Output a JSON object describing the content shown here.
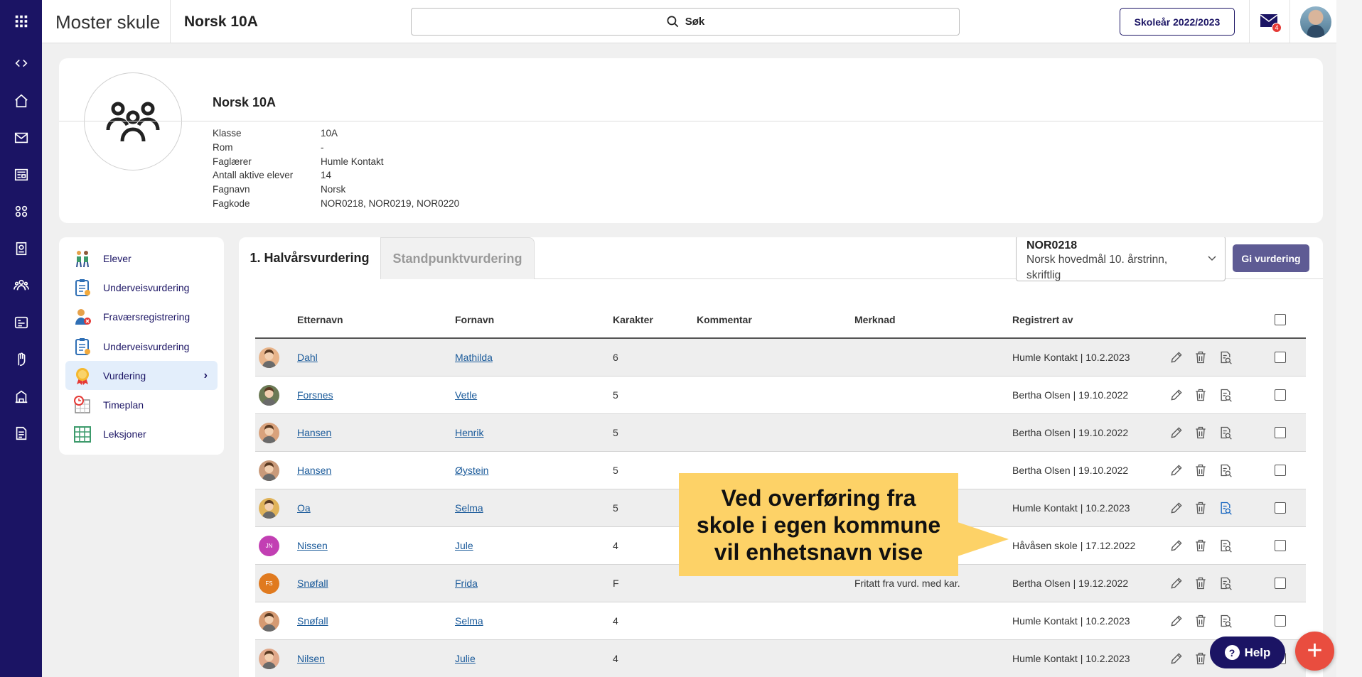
{
  "topbar": {
    "app_title": "Moster skule",
    "context_title": "Norsk 10A",
    "search_label": "Søk",
    "school_year_button": "Skoleår 2022/2023",
    "mail_badge": "4"
  },
  "group": {
    "title": "Norsk 10A",
    "info": [
      {
        "key": "Klasse",
        "value": "10A"
      },
      {
        "key": "Rom",
        "value": "-"
      },
      {
        "key": "Faglærer",
        "value": "Humle Kontakt"
      },
      {
        "key": "Antall aktive elever",
        "value": "14"
      },
      {
        "key": "Fagnavn",
        "value": "Norsk"
      },
      {
        "key": "Fagkode",
        "value": "NOR0218, NOR0219, NOR0220"
      }
    ]
  },
  "side_menu": {
    "items": [
      {
        "label": "Elever",
        "icon": "students-icon"
      },
      {
        "label": "Underveisvurdering",
        "icon": "clipboard-icon"
      },
      {
        "label": "Fraværsregistrering",
        "icon": "absence-icon"
      },
      {
        "label": "Underveisvurdering",
        "icon": "clipboard-icon"
      },
      {
        "label": "Vurdering",
        "icon": "medal-icon",
        "active": true
      },
      {
        "label": "Timeplan",
        "icon": "schedule-icon"
      },
      {
        "label": "Leksjoner",
        "icon": "lessons-icon"
      }
    ]
  },
  "tabs": {
    "tab1": "1. Halvårsvurdering",
    "tab2": "Standpunktvurdering"
  },
  "course_select": {
    "code": "NOR0218",
    "name": "Norsk hovedmål 10. årstrinn, skriftlig"
  },
  "give_button": "Gi vurdering",
  "table": {
    "headers": {
      "etternavn": "Etternavn",
      "fornavn": "Fornavn",
      "karakter": "Karakter",
      "kommentar": "Kommentar",
      "merknad": "Merknad",
      "registrert": "Registrert av"
    },
    "rows": [
      {
        "etternavn": "Dahl",
        "fornavn": "Mathilda",
        "karakter": "6",
        "kommentar": "",
        "merknad": "",
        "registrert": "Humle Kontakt | 10.2.2023",
        "avatar": "photo"
      },
      {
        "etternavn": "Forsnes",
        "fornavn": "Vetle",
        "karakter": "5",
        "kommentar": "",
        "merknad": "",
        "registrert": "Bertha Olsen | 19.10.2022",
        "avatar": "photo"
      },
      {
        "etternavn": "Hansen",
        "fornavn": "Henrik",
        "karakter": "5",
        "kommentar": "",
        "merknad": "",
        "registrert": "Bertha Olsen | 19.10.2022",
        "avatar": "photo"
      },
      {
        "etternavn": "Hansen",
        "fornavn": "Øystein",
        "karakter": "5",
        "kommentar": "",
        "merknad": "",
        "registrert": "Bertha Olsen | 19.10.2022",
        "avatar": "photo"
      },
      {
        "etternavn": "Oa",
        "fornavn": "Selma",
        "karakter": "5",
        "kommentar": "",
        "merknad": "",
        "registrert": "Humle Kontakt | 10.2.2023",
        "avatar": "photo"
      },
      {
        "etternavn": "Nissen",
        "fornavn": "Jule",
        "karakter": "4",
        "kommentar": "",
        "merknad": "",
        "registrert": "Håvåsen skole | 17.12.2022",
        "avatar": "JN"
      },
      {
        "etternavn": "Snøfall",
        "fornavn": "Frida",
        "karakter": "F",
        "kommentar": "",
        "merknad": "Fritatt fra vurd. med kar.",
        "registrert": "Bertha Olsen | 19.12.2022",
        "avatar": "FS"
      },
      {
        "etternavn": "Snøfall",
        "fornavn": "Selma",
        "karakter": "4",
        "kommentar": "",
        "merknad": "",
        "registrert": "Humle Kontakt | 10.2.2023",
        "avatar": "photo"
      },
      {
        "etternavn": "Nilsen",
        "fornavn": "Julie",
        "karakter": "4",
        "kommentar": "",
        "merknad": "",
        "registrert": "Humle Kontakt | 10.2.2023",
        "avatar": "photo"
      }
    ]
  },
  "callout": {
    "line1": "Ved overføring fra",
    "line2": "skole i egen kommune",
    "line3": "vil enhetsnavn vise"
  },
  "help_button": "Help",
  "colors": {
    "navy": "#1b1464",
    "callout": "#fdd267",
    "fab": "#e94d3f",
    "active_menu": "#e3eefb",
    "give_button": "#5e5b94"
  }
}
